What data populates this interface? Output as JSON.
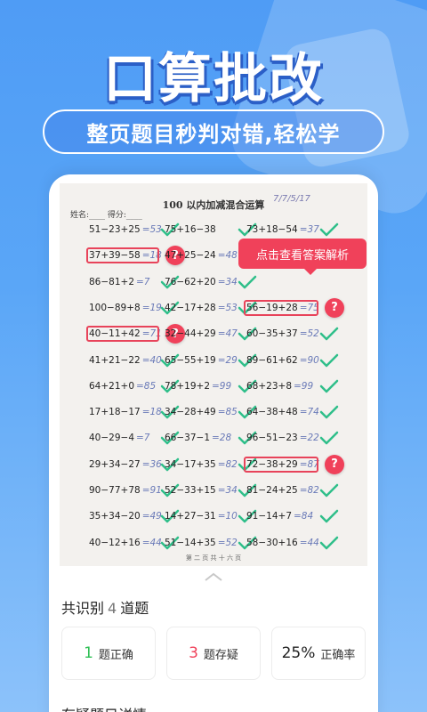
{
  "headline": "口算批改",
  "subtitle": "整页题目秒判对错,轻松学",
  "paper": {
    "title": "100 以内加减混合运算",
    "name_line": "姓名:____  得分:____",
    "signature": "7/7/5/17",
    "footer": "第 二 页 共 十 六 页"
  },
  "problems": [
    {
      "q": "51−23+25",
      "a": "=53",
      "mark": "check",
      "col": 0,
      "row": 0
    },
    {
      "q": "75+16−38",
      "a": "",
      "mark": "check",
      "col": 1,
      "row": 0
    },
    {
      "q": "73+18−54",
      "a": "=37",
      "mark": "check",
      "col": 2,
      "row": 0
    },
    {
      "q": "37+39−58",
      "a": "=18",
      "mark": "question",
      "col": 0,
      "row": 1
    },
    {
      "q": "47+25−24",
      "a": "=48",
      "mark": "none",
      "col": 1,
      "row": 1
    },
    {
      "q": "86−81+2",
      "a": "=7",
      "mark": "check",
      "col": 0,
      "row": 2
    },
    {
      "q": "76−62+20",
      "a": "=34",
      "mark": "check",
      "col": 1,
      "row": 2
    },
    {
      "q": "100−89+8",
      "a": "=19",
      "mark": "check",
      "col": 0,
      "row": 3
    },
    {
      "q": "42−17+28",
      "a": "=53",
      "mark": "check",
      "col": 1,
      "row": 3
    },
    {
      "q": "56−19+28",
      "a": "=75",
      "mark": "question",
      "col": 2,
      "row": 3
    },
    {
      "q": "40−11+42",
      "a": "=71",
      "mark": "question",
      "col": 0,
      "row": 4
    },
    {
      "q": "32−44+29",
      "a": "=47",
      "mark": "check",
      "col": 1,
      "row": 4
    },
    {
      "q": "60−35+37",
      "a": "=52",
      "mark": "check",
      "col": 2,
      "row": 4
    },
    {
      "q": "41+21−22",
      "a": "=40",
      "mark": "check",
      "col": 0,
      "row": 5
    },
    {
      "q": "65−55+19",
      "a": "=29",
      "mark": "check",
      "col": 1,
      "row": 5
    },
    {
      "q": "89−61+62",
      "a": "=90",
      "mark": "check",
      "col": 2,
      "row": 5
    },
    {
      "q": "64+21+0",
      "a": "=85",
      "mark": "check",
      "col": 0,
      "row": 6
    },
    {
      "q": "78+19+2",
      "a": "=99",
      "mark": "check",
      "col": 1,
      "row": 6
    },
    {
      "q": "68+23+8",
      "a": "=99",
      "mark": "check",
      "col": 2,
      "row": 6
    },
    {
      "q": "17+18−17",
      "a": "=18",
      "mark": "check",
      "col": 0,
      "row": 7
    },
    {
      "q": "34−28+49",
      "a": "=85",
      "mark": "check",
      "col": 1,
      "row": 7
    },
    {
      "q": "64−38+48",
      "a": "=74",
      "mark": "check",
      "col": 2,
      "row": 7
    },
    {
      "q": "40−29−4",
      "a": "=7",
      "mark": "check",
      "col": 0,
      "row": 8
    },
    {
      "q": "66−37−1",
      "a": "=28",
      "mark": "check",
      "col": 1,
      "row": 8
    },
    {
      "q": "96−51−23",
      "a": "=22",
      "mark": "check",
      "col": 2,
      "row": 8
    },
    {
      "q": "29+34−27",
      "a": "=36",
      "mark": "check",
      "col": 0,
      "row": 9
    },
    {
      "q": "34−17+35",
      "a": "=82",
      "mark": "check",
      "col": 1,
      "row": 9
    },
    {
      "q": "72−38+29",
      "a": "=87",
      "mark": "question",
      "col": 2,
      "row": 9
    },
    {
      "q": "90−77+78",
      "a": "=91",
      "mark": "check",
      "col": 0,
      "row": 10
    },
    {
      "q": "52−33+15",
      "a": "=34",
      "mark": "check",
      "col": 1,
      "row": 10
    },
    {
      "q": "81−24+25",
      "a": "=82",
      "mark": "check",
      "col": 2,
      "row": 10
    },
    {
      "q": "35+34−20",
      "a": "=49",
      "mark": "check",
      "col": 0,
      "row": 11
    },
    {
      "q": "14+27−31",
      "a": "=10",
      "mark": "check",
      "col": 1,
      "row": 11
    },
    {
      "q": "91−14+7",
      "a": "=84",
      "mark": "check",
      "col": 2,
      "row": 11
    },
    {
      "q": "40−12+16",
      "a": "=44",
      "mark": "check",
      "col": 0,
      "row": 12
    },
    {
      "q": "51−14+35",
      "a": "=52",
      "mark": "check",
      "col": 1,
      "row": 12
    },
    {
      "q": "58−30+16",
      "a": "=44",
      "mark": "check",
      "col": 2,
      "row": 12
    }
  ],
  "tooltip": "点击查看答案解析",
  "summary": {
    "prefix": "共识别",
    "count": "4",
    "suffix": "道题"
  },
  "stats": [
    {
      "value": "1",
      "label": "题正确",
      "color": "#2fbf55"
    },
    {
      "value": "3",
      "label": "题存疑",
      "color": "#f0415a"
    },
    {
      "value": "25%",
      "label": "正确率",
      "color": "#222222"
    }
  ],
  "bottom_title": "存疑题目详情",
  "colors": {
    "check": "#2fbf8a",
    "question": "#f0415a",
    "accent": "#4f9cf5"
  },
  "icons": {
    "check": "check-icon",
    "question": "question-icon",
    "grabber": "chevron-up-icon"
  }
}
